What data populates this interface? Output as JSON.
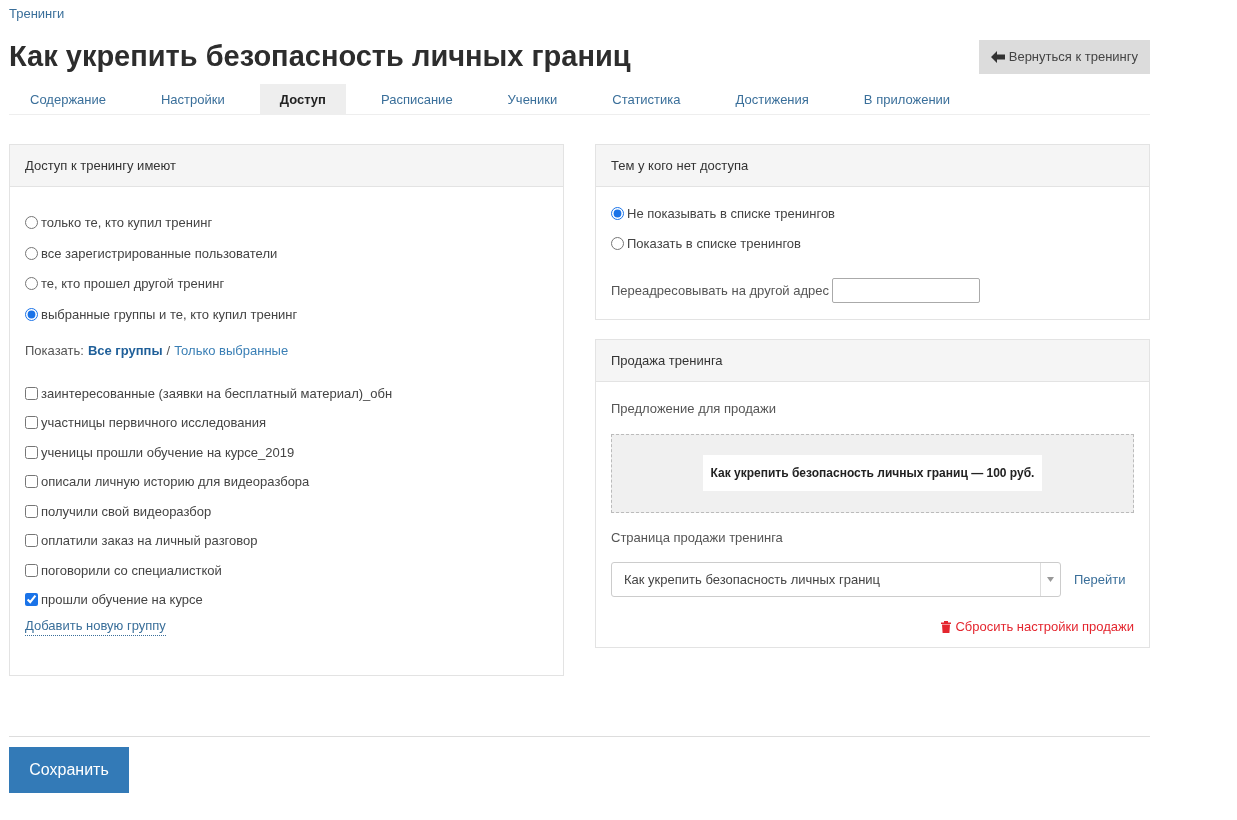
{
  "breadcrumb": "Тренинги",
  "title": "Как укрепить безопасность личных границ",
  "back_button": "Вернуться к тренингу",
  "tabs": [
    {
      "label": "Содержание",
      "selected": false
    },
    {
      "label": "Настройки",
      "selected": false
    },
    {
      "label": "Доступ",
      "selected": true
    },
    {
      "label": "Расписание",
      "selected": false
    },
    {
      "label": "Ученики",
      "selected": false
    },
    {
      "label": "Статистика",
      "selected": false
    },
    {
      "label": "Достижения",
      "selected": false
    },
    {
      "label": "В приложении",
      "selected": false
    }
  ],
  "access_panel": {
    "title": "Доступ к тренингу имеют",
    "options": [
      {
        "label": "только те, кто купил тренинг",
        "selected": false
      },
      {
        "label": "все зарегистрированные пользователи",
        "selected": false
      },
      {
        "label": "те, кто прошел другой тренинг",
        "selected": false
      },
      {
        "label": "выбранные группы и те, кто купил тренинг",
        "selected": true
      }
    ],
    "filter_label": "Показать:",
    "filters": [
      {
        "label": "Все группы",
        "selected": true
      },
      {
        "label": "Только выбранные",
        "selected": false
      }
    ],
    "filter_separator": "/",
    "groups": [
      {
        "label": "заинтересованные (заявки на бесплатный материал)_обн",
        "checked": false
      },
      {
        "label": "участницы первичного исследования",
        "checked": false
      },
      {
        "label": "ученицы прошли обучение на курсе_2019",
        "checked": false
      },
      {
        "label": "описали личную историю для видеоразбора",
        "checked": false
      },
      {
        "label": "получили свой видеоразбор",
        "checked": false
      },
      {
        "label": "оплатили заказ на личный разговор",
        "checked": false
      },
      {
        "label": "поговорили со специалисткой",
        "checked": false
      },
      {
        "label": "прошли обучение на курсе",
        "checked": true
      }
    ],
    "add_group_link": "Добавить новую группу"
  },
  "no_access_panel": {
    "title": "Тем у кого нет доступа",
    "options": [
      {
        "label": "Не показывать в списке тренингов",
        "selected": true
      },
      {
        "label": "Показать в списке тренингов",
        "selected": false
      }
    ],
    "redirect_label": "Переадресовывать на другой адрес"
  },
  "sale_panel": {
    "title": "Продажа тренинга",
    "offer_label": "Предложение для продажи",
    "offer": "Как укрепить безопасность личных границ — 100 руб.",
    "page_label": "Страница продажи тренинга",
    "page_select": "Как укрепить безопасность личных границ",
    "go_link": "Перейти",
    "reset_link": "Сбросить настройки продажи"
  },
  "save_button": "Сохранить"
}
